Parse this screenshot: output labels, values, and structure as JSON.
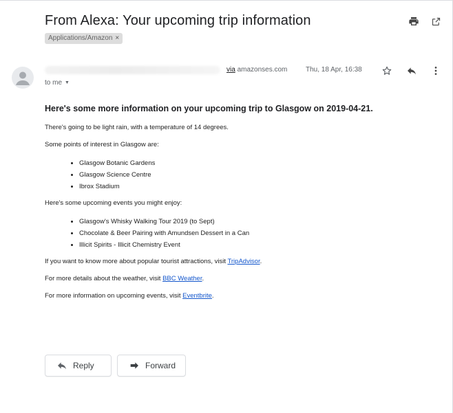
{
  "email": {
    "subject": "From Alexa: Your upcoming trip information",
    "label": "Applications/Amazon",
    "label_remove": "×",
    "via_word": "via",
    "via_domain": " amazonses.com",
    "date": "Thu, 18 Apr, 16:38",
    "recipient": "to me"
  },
  "body": {
    "heading": "Here's some more information on your upcoming trip to Glasgow on 2019-04-21.",
    "weather_line": "There's going to be light rain, with a temperature of 14 degrees.",
    "poi_intro": "Some points of interest in Glasgow are:",
    "poi": [
      "Glasgow Botanic Gardens",
      "Glasgow Science Centre",
      "Ibrox Stadium"
    ],
    "events_intro": "Here's some upcoming events you might enjoy:",
    "events": [
      "Glasgow's Whisky Walking Tour 2019 (to Sept)",
      "Chocolate & Beer Pairing with Amundsen Dessert in a Can",
      "Illicit Spirits - Illicit Chemistry Event"
    ],
    "tripadvisor_prefix": "If you want to know more about popular tourist attractions, visit ",
    "tripadvisor_link": "TripAdvisor",
    "tripadvisor_suffix": ".",
    "weather_prefix": "For more details about the weather, visit ",
    "weather_link": "BBC Weather",
    "weather_suffix": ".",
    "events_prefix": "For more information on upcoming events, visit ",
    "events_link": "Eventbrite",
    "events_suffix": "."
  },
  "actions": {
    "reply_label": "Reply",
    "forward_label": "Forward"
  },
  "icons": {
    "print": "print-icon",
    "popout": "open-in-new-window-icon",
    "star": "star-icon",
    "reply": "reply-icon",
    "more": "more-vert-icon",
    "forward": "forward-icon"
  },
  "colors": {
    "link": "#1155cc",
    "chip_bg": "#dddddd",
    "text": "#202124"
  }
}
